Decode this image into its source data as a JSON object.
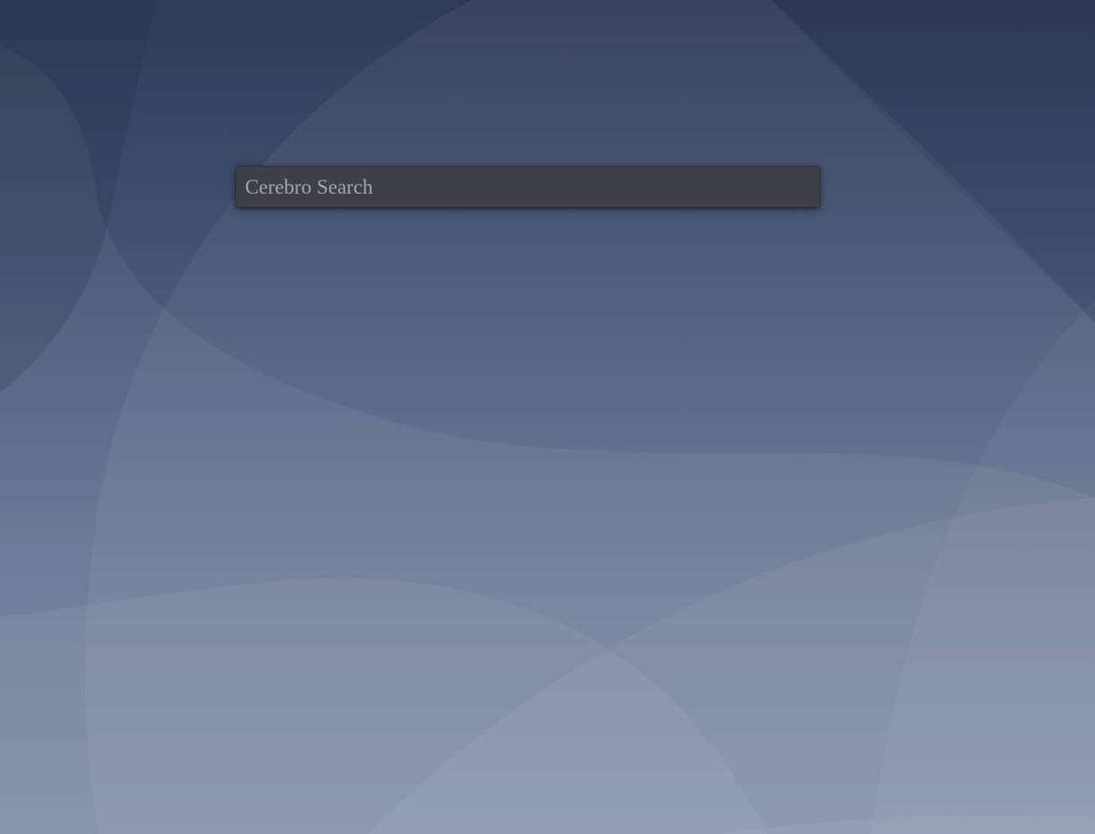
{
  "search": {
    "placeholder": "Cerebro Search",
    "value": ""
  },
  "colors": {
    "search_bar_background": "#3d4044",
    "placeholder_text": "#a3a6a9",
    "wallpaper_top": "#2e3b55",
    "wallpaper_bottom": "#7b8ba5"
  }
}
